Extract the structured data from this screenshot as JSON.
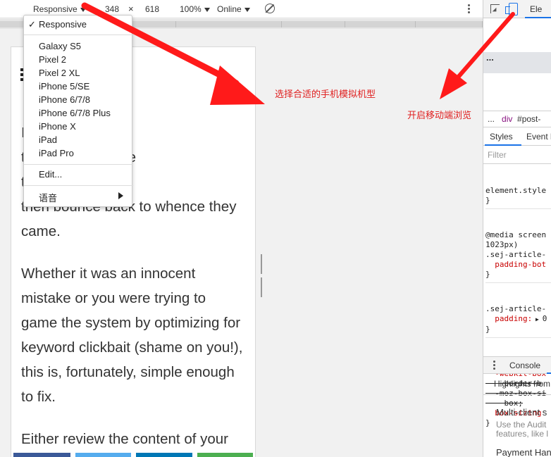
{
  "toolbar": {
    "device_select": "Responsive",
    "width": "348",
    "times": "×",
    "height": "618",
    "zoom": "100%",
    "throttle": "Online"
  },
  "device_menu": {
    "selected": "Responsive",
    "checkmark": "✓",
    "devices": [
      "Galaxy S5",
      "Pixel 2",
      "Pixel 2 XL",
      "iPhone 5/SE",
      "iPhone 6/7/8",
      "iPhone 6/7/8 Plus",
      "iPhone X",
      "iPad",
      "iPad Pro"
    ],
    "edit": "Edit...",
    "language": "语音"
  },
  "article": {
    "paragraph1": [
      "I                   y enter your site",
      "t                tent is about one",
      "t                    that it isn’t, and",
      "then bounce back to whence they",
      "came."
    ],
    "paragraph2": [
      "Whether it was an innocent",
      "mistake or you were trying to",
      "game the system by optimizing for",
      "keyword clickbait (shame on you!),",
      "this is, fortunately, simple enough",
      "to fix."
    ],
    "paragraph3": [
      "Either review the content of your"
    ]
  },
  "share_colors": [
    "#3b5998",
    "#55acee",
    "#0077b5",
    "#4caf50"
  ],
  "devtools": {
    "tab_elements": "Ele",
    "ellipsis": "...",
    "breadcrumb_dots": "...",
    "breadcrumb_div": "div",
    "breadcrumb_post": "#post-",
    "tab_styles": "Styles",
    "tab_event": "Event l",
    "filter_placeholder": "Filter",
    "rule1": [
      "element.style",
      "}"
    ],
    "rule2": [
      "@media screen",
      "1023px)",
      ".sej-article-",
      "  padding-bot",
      "}"
    ],
    "rule3": [
      ".sej-article-",
      "  padding:",
      "}"
    ],
    "rule3_value": "0",
    "rule4_open": "* {",
    "rule4_webkit": "  -webkit-box",
    "rule4_border": "    border-b",
    "rule4_moz": "  -moz-box-si",
    "rule4_box": "    box;",
    "rule4_sizing": "  box-sizing",
    "rule4_close": "}",
    "console_tab": "Console",
    "highlights": "Highlights from",
    "whatsnew_title": "Multi-client s",
    "whatsnew_desc": [
      "Use the Audit",
      "features, like l"
    ],
    "whatsnew_next": "Payment Han"
  },
  "annotations": {
    "select_device": "选择合适的手机模拟机型",
    "enable_mobile": "开启移动端浏览"
  },
  "annotation_color": "#ff1a1a",
  "accent_color": "#1a73e8"
}
